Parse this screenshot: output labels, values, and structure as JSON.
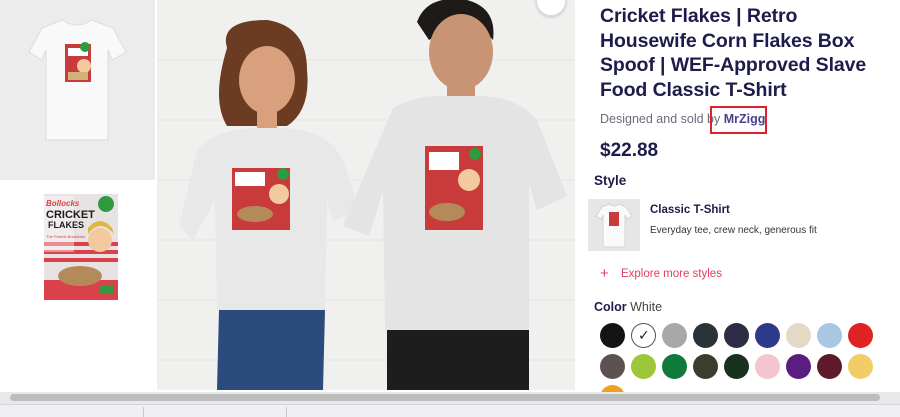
{
  "product": {
    "title": "Cricket Flakes | Retro Housewife Corn Flakes Box Spoof | WEF-Approved Slave Food Classic T-Shirt",
    "seller_prefix": "Designed and sold by",
    "seller_name": "MrZigg",
    "price": "$22.88"
  },
  "artwork": {
    "brand": "Bollocks",
    "name_line1": "CRICKET",
    "name_line2": "FLAKES",
    "tagline": "The Protein Breakfast"
  },
  "style": {
    "heading": "Style",
    "name": "Classic T-Shirt",
    "description": "Everyday tee, crew neck, generous fit",
    "explore_label": "Explore more styles"
  },
  "color": {
    "heading": "Color",
    "selected": "White",
    "swatches": [
      "#141414",
      "#ffffff",
      "#a8a8a8",
      "#2a3338",
      "#2c2c44",
      "#2d3a8a",
      "#e4d9c6",
      "#a8c7e2",
      "#dd2323",
      "#5d5250",
      "#9dc63a",
      "#0f7a3a",
      "#3d3d2e",
      "#183020",
      "#f4c4cf",
      "#5a1e80",
      "#5e1a2a",
      "#f2cc66",
      "#f0a020"
    ]
  }
}
